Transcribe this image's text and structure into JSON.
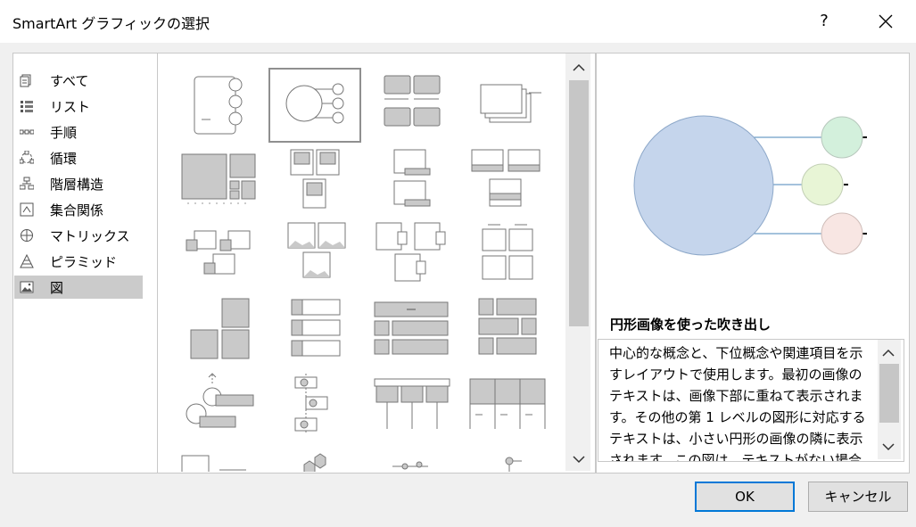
{
  "dialog": {
    "title": "SmartArt グラフィックの選択",
    "help_glyph": "?"
  },
  "categories": [
    {
      "label": "すべて",
      "icon": "all-icon"
    },
    {
      "label": "リスト",
      "icon": "list-icon"
    },
    {
      "label": "手順",
      "icon": "process-icon"
    },
    {
      "label": "循環",
      "icon": "cycle-icon"
    },
    {
      "label": "階層構造",
      "icon": "hierarchy-icon"
    },
    {
      "label": "集合関係",
      "icon": "relationship-icon"
    },
    {
      "label": "マトリックス",
      "icon": "matrix-icon"
    },
    {
      "label": "ピラミッド",
      "icon": "pyramid-icon"
    },
    {
      "label": "図",
      "icon": "picture-icon",
      "selected": true
    }
  ],
  "gallery": {
    "selected_index": 1,
    "rows_visible": 6,
    "columns": 4
  },
  "preview": {
    "name": "円形画像を使った吹き出し",
    "description": "中心的な概念と、下位概念や関連項目を示すレイアウトで使用します。最初の画像のテキストは、画像下部に重ねて表示されます。その他の第 1 レベルの図形に対応するテキストは、小さい円形の画像の隣に表示されます。この図は、テキストがない場合でも適切に表示されます。"
  },
  "buttons": {
    "ok": "OK",
    "cancel": "キャンセル"
  },
  "colors": {
    "accent": "#0078d7",
    "selection": "#cbcbcb",
    "big_circle": "#c5d5ec",
    "circle_green": "#d3f0dc",
    "circle_lime": "#e8f5d6",
    "circle_pink": "#f8e6e3"
  }
}
